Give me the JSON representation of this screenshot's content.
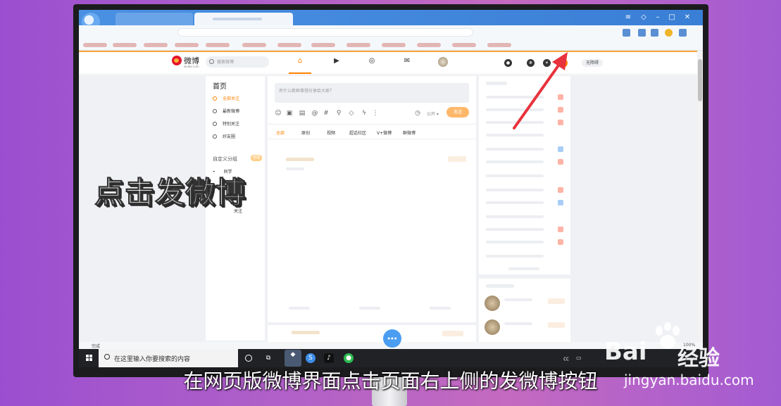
{
  "overlay": {
    "caption": "点击发微博",
    "subtitle": "在网页版微博界面点击页面右上侧的发微博按钮"
  },
  "watermark": {
    "brand": "Bai",
    "jingyan": "经验",
    "url": "jingyan.baidu.com"
  },
  "weibo": {
    "logo_text": "微博",
    "logo_sub": "weibo.com",
    "search_placeholder": "搜索微博",
    "wuzhang_label": "无障碍",
    "left_nav": {
      "title": "首页",
      "items": [
        "全部关注",
        "最新微博",
        "特别关注",
        "好友圈"
      ],
      "custom_group_label": "自定义分组",
      "manage_label": "管理",
      "group_items": [
        "同学",
        "",
        "关注"
      ]
    },
    "compose_placeholder": "有什么新鲜事想分享给大家？",
    "visibility_label": "公开",
    "send_label": "发送",
    "feed_tabs": [
      "全部",
      "原创",
      "视频",
      "超话社区",
      "V+微博",
      "群微博"
    ]
  },
  "status": {
    "left": "完成",
    "zoom": "100%"
  },
  "taskbar": {
    "search_placeholder": "在这里输入你要搜索的内容"
  },
  "icons": {
    "home": "home-icon",
    "video": "video-icon",
    "discover": "discover-icon",
    "mail": "mail-icon",
    "post": "compose-icon"
  },
  "colors": {
    "weibo_orange": "#ff8200",
    "arrow_red": "#e8323c",
    "taskbar": "#202226"
  }
}
